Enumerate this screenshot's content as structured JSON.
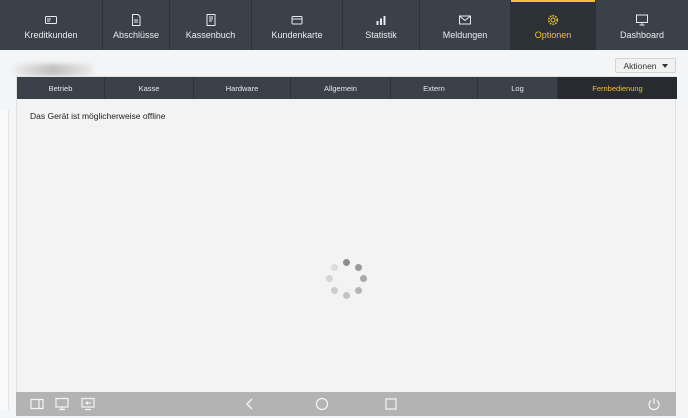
{
  "topnav": {
    "items": [
      {
        "label": "Kreditkunden",
        "icon": "card-icon"
      },
      {
        "label": "Abschlüsse",
        "icon": "document-icon"
      },
      {
        "label": "Kassenbuch",
        "icon": "book-icon"
      },
      {
        "label": "Kundenkarte",
        "icon": "wallet-icon"
      },
      {
        "label": "Statistik",
        "icon": "chart-icon"
      },
      {
        "label": "Meldungen",
        "icon": "envelope-icon"
      },
      {
        "label": "Optionen",
        "icon": "gear-icon",
        "active": true
      },
      {
        "label": "Dashboard",
        "icon": "monitor-icon"
      }
    ],
    "accent_color": "#f2c230",
    "background_color": "#3b4148"
  },
  "header": {
    "actions_label": "Aktionen"
  },
  "tabs": [
    {
      "label": "Betrieb"
    },
    {
      "label": "Kasse"
    },
    {
      "label": "Hardware"
    },
    {
      "label": "Allgemein"
    },
    {
      "label": "Extern"
    },
    {
      "label": "Log"
    },
    {
      "label": "Fernbedienung",
      "active": true
    }
  ],
  "content": {
    "offline_message": "Das Gerät ist möglicherweise offline"
  },
  "bottombar": {
    "left_icons": [
      "sidebar-panel-icon",
      "monitor-icon",
      "screen-share-icon"
    ],
    "center_icons": [
      "back-icon",
      "home-circle-icon",
      "recent-square-icon"
    ],
    "right_icons": [
      "power-icon"
    ]
  }
}
